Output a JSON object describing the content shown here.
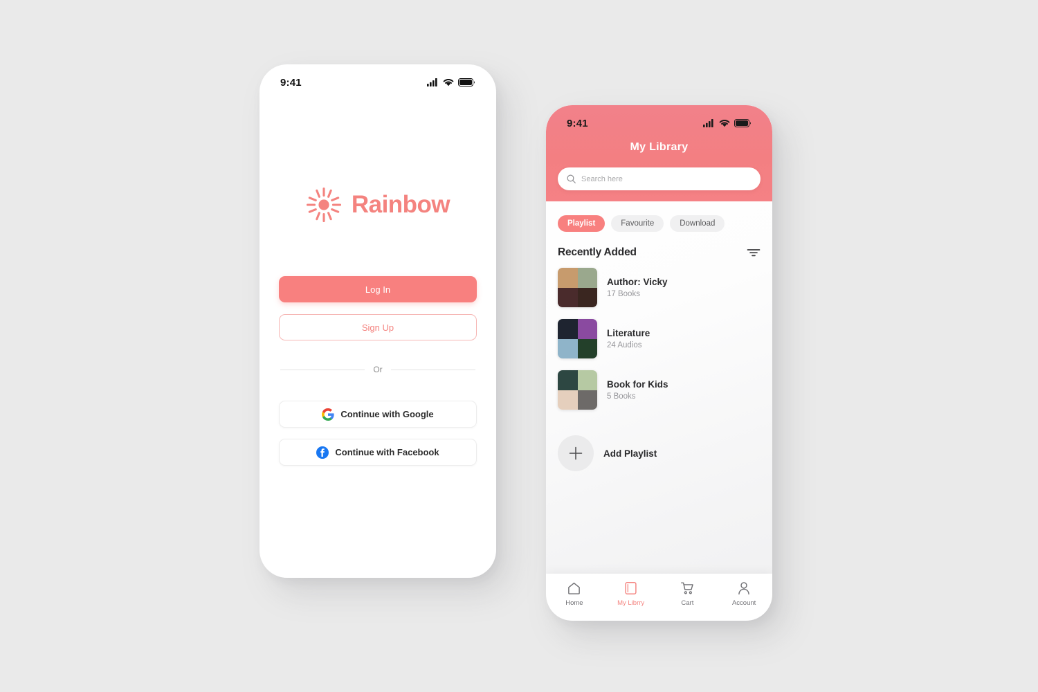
{
  "canvas": {
    "background": "#eaeaea"
  },
  "theme": {
    "coral": "#f8807f",
    "coral_header": "#f17d85",
    "coral_text": "#f4837f",
    "chip_inactive_bg": "#f0f0f1",
    "dark_text": "#2a2a2c",
    "muted_text": "#96969a"
  },
  "login_screen": {
    "status_bar": {
      "time": "9:41",
      "icons": [
        "signal-icon",
        "wifi-icon",
        "battery-icon"
      ]
    },
    "logo": {
      "icon": "sunburst-icon",
      "text": "Rainbow"
    },
    "buttons": {
      "login": "Log In",
      "signup": "Sign Up"
    },
    "divider_text": "Or",
    "social": [
      {
        "icon": "google-icon",
        "label": "Continue with Google"
      },
      {
        "icon": "facebook-icon",
        "label": "Continue with Facebook"
      }
    ]
  },
  "library_screen": {
    "status_bar": {
      "time": "9:41",
      "icons": [
        "signal-icon",
        "wifi-icon",
        "battery-icon"
      ]
    },
    "title": "My Library",
    "search": {
      "icon": "search-icon",
      "placeholder": "Search here",
      "value": ""
    },
    "chips": [
      {
        "label": "Playlist",
        "active": true
      },
      {
        "label": "Favourite",
        "active": false
      },
      {
        "label": "Download",
        "active": false
      }
    ],
    "section": {
      "title": "Recently Added",
      "filter_icon": "filter-icon"
    },
    "items": [
      {
        "title": "Author: Vicky",
        "subtitle": "17 Books",
        "thumb_colors": [
          "#c79b6d",
          "#9aa88d",
          "#4a2b2c",
          "#3a2620"
        ]
      },
      {
        "title": "Literature",
        "subtitle": "24 Audios",
        "thumb_colors": [
          "#1e2430",
          "#8a4aa0",
          "#8fb4c9",
          "#23402a"
        ]
      },
      {
        "title": "Book for Kids",
        "subtitle": "5 Books",
        "thumb_colors": [
          "#2d4742",
          "#b6c9a3",
          "#e5cfbd",
          "#6d6a68"
        ]
      }
    ],
    "add_playlist": {
      "icon": "plus-icon",
      "label": "Add Playlist"
    },
    "tabs": [
      {
        "icon": "home-icon",
        "label": "Home",
        "active": false
      },
      {
        "icon": "book-icon",
        "label": "My Librry",
        "active": true
      },
      {
        "icon": "cart-icon",
        "label": "Cart",
        "active": false
      },
      {
        "icon": "account-icon",
        "label": "Account",
        "active": false
      }
    ]
  }
}
